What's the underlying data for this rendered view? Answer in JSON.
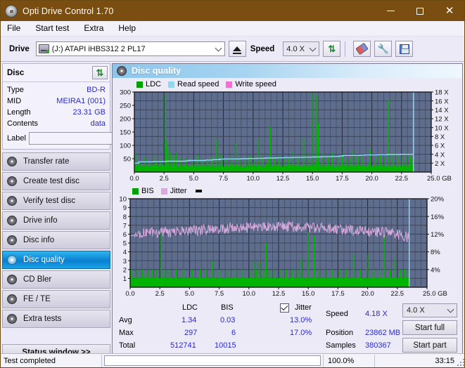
{
  "window": {
    "title": "Opti Drive Control 1.70",
    "icon": "disc-icon",
    "minimize": "–",
    "maximize": "▢",
    "close": "✕"
  },
  "menu": {
    "items": [
      "File",
      "Start test",
      "Extra",
      "Help"
    ]
  },
  "toolbar": {
    "drive_label": "Drive",
    "drive_value": "(J:)  ATAPI iHBS312  2 PL17",
    "eject_title": "Eject",
    "speed_label": "Speed",
    "speed_value": "4.0 X",
    "refresh_title": "Refresh",
    "erase_title": "Erase",
    "tools_title": "Tools",
    "save_title": "Save"
  },
  "disc": {
    "group_title": "Disc",
    "refresh_title": "Refresh disc info",
    "rows": [
      {
        "key": "Type",
        "value": "BD-R"
      },
      {
        "key": "MID",
        "value": "MEIRA1 (001)"
      },
      {
        "key": "Length",
        "value": "23.31 GB"
      },
      {
        "key": "Contents",
        "value": "data"
      }
    ],
    "label_key": "Label",
    "label_value": "",
    "label_placeholder": ""
  },
  "nav": {
    "items": [
      {
        "label": "Transfer rate",
        "active": false
      },
      {
        "label": "Create test disc",
        "active": false
      },
      {
        "label": "Verify test disc",
        "active": false
      },
      {
        "label": "Drive info",
        "active": false
      },
      {
        "label": "Disc info",
        "active": false
      },
      {
        "label": "Disc quality",
        "active": true
      },
      {
        "label": "CD Bler",
        "active": false
      },
      {
        "label": "FE / TE",
        "active": false
      },
      {
        "label": "Extra tests",
        "active": false
      }
    ],
    "status_window": "Status window >>"
  },
  "panel": {
    "title": "Disc quality"
  },
  "colors": {
    "ldc": "#00b400",
    "bis": "#00b400",
    "read_speed": "#8fd8f2",
    "write_speed": "#ff6ad5",
    "jitter": "#d9a8dd",
    "plot_bg": "#5e6d8e",
    "grid": "#3a4358",
    "accent_blue": "#2a2ad0",
    "title_bar": "#7a4d11"
  },
  "stats": {
    "col_headers": [
      "LDC",
      "BIS"
    ],
    "row_labels": [
      "Avg",
      "Max",
      "Total"
    ],
    "ldc": {
      "avg": "1.34",
      "max": "297",
      "total": "512741"
    },
    "bis": {
      "avg": "0.03",
      "max": "6",
      "total": "10015"
    },
    "jitter_label": "Jitter",
    "jitter_checked": true,
    "jitter_avg": "13.0%",
    "jitter_max": "17.0%",
    "speed_label": "Speed",
    "speed_value": "4.18 X",
    "position_label": "Position",
    "position_value": "23862 MB",
    "samples_label": "Samples",
    "samples_value": "380367",
    "speed_select": "4.0 X",
    "start_full": "Start full",
    "start_part": "Start part"
  },
  "statusbar": {
    "message": "Test completed",
    "progress_percent": "100.0%",
    "progress_value": 100,
    "elapsed": "33:15"
  },
  "chart_data": [
    {
      "type": "line",
      "name": "ldc-chart",
      "title": "",
      "legend": [
        {
          "label": "LDC",
          "color": "#00b400"
        },
        {
          "label": "Read speed",
          "color": "#8fd8f2"
        },
        {
          "label": "Write speed",
          "color": "#ff6ad5"
        }
      ],
      "legend_position": "top-left",
      "xlabel": "GB",
      "ylabel": "LDC",
      "xlim": [
        0,
        25
      ],
      "ylim": [
        0,
        300
      ],
      "y2lim": [
        0,
        18
      ],
      "y2label": "X",
      "xticks": [
        0.0,
        2.5,
        5.0,
        7.5,
        10.0,
        12.5,
        15.0,
        17.5,
        20.0,
        22.5,
        25.0
      ],
      "xtick_labels": [
        "0.0",
        "2.5",
        "5.0",
        "7.5",
        "10.0",
        "12.5",
        "15.0",
        "17.5",
        "20.0",
        "22.5",
        "25.0 GB"
      ],
      "yticks": [
        0,
        50,
        100,
        150,
        200,
        250,
        300
      ],
      "ytick_labels": [
        "",
        "50",
        "100",
        "150",
        "200",
        "250",
        "300"
      ],
      "y2ticks": [
        2,
        4,
        6,
        8,
        10,
        12,
        14,
        16,
        18
      ],
      "y2tick_labels": [
        "2 X",
        "4 X",
        "6 X",
        "8 X",
        "10 X",
        "12 X",
        "14 X",
        "16 X",
        "18 X"
      ],
      "grid": true,
      "data_end_x": 23.5,
      "series": [
        {
          "name": "LDC",
          "color": "#00b400",
          "style": "spikes",
          "baseline": 18,
          "noise_amp": 14,
          "spikes": [
            [
              0.05,
              68
            ],
            [
              0.45,
              42
            ],
            [
              0.9,
              55
            ],
            [
              1.35,
              38
            ],
            [
              1.8,
              62
            ],
            [
              2.2,
              48
            ],
            [
              2.62,
              292
            ],
            [
              2.72,
              118
            ],
            [
              2.85,
              96
            ],
            [
              3.05,
              74
            ],
            [
              3.3,
              60
            ],
            [
              3.55,
              70
            ],
            [
              3.9,
              52
            ],
            [
              4.4,
              58
            ],
            [
              4.9,
              46
            ],
            [
              5.3,
              64
            ],
            [
              5.7,
              50
            ],
            [
              6.1,
              44
            ],
            [
              6.5,
              58
            ],
            [
              6.95,
              122
            ],
            [
              7.3,
              66
            ],
            [
              7.7,
              52
            ],
            [
              8.1,
              60
            ],
            [
              8.55,
              108
            ],
            [
              8.9,
              58
            ],
            [
              9.3,
              50
            ],
            [
              9.7,
              64
            ],
            [
              10.1,
              56
            ],
            [
              10.45,
              126
            ],
            [
              10.8,
              60
            ],
            [
              11.2,
              52
            ],
            [
              11.45,
              170
            ],
            [
              11.8,
              58
            ],
            [
              12.2,
              64
            ],
            [
              12.6,
              50
            ],
            [
              13.0,
              56
            ],
            [
              13.4,
              76
            ],
            [
              13.8,
              62
            ],
            [
              14.25,
              128
            ],
            [
              14.6,
              66
            ],
            [
              14.98,
              297
            ],
            [
              15.35,
              290
            ],
            [
              15.5,
              184
            ],
            [
              15.9,
              70
            ],
            [
              16.3,
              60
            ],
            [
              16.7,
              74
            ],
            [
              17.1,
              58
            ],
            [
              17.5,
              66
            ],
            [
              17.9,
              52
            ],
            [
              18.4,
              80
            ],
            [
              18.8,
              64
            ],
            [
              19.2,
              58
            ],
            [
              19.85,
              86
            ],
            [
              20.3,
              56
            ],
            [
              20.7,
              62
            ],
            [
              21.1,
              58
            ],
            [
              21.45,
              272
            ],
            [
              21.8,
              70
            ],
            [
              22.2,
              66
            ],
            [
              22.55,
              58
            ],
            [
              22.9,
              74
            ],
            [
              23.2,
              60
            ],
            [
              23.4,
              52
            ]
          ]
        },
        {
          "name": "Read speed",
          "color": "#8fd8f2",
          "style": "step-line",
          "axis": "y2",
          "points": [
            [
              0.0,
              2.0
            ],
            [
              0.3,
              2.0
            ],
            [
              0.35,
              2.3
            ],
            [
              1.5,
              2.3
            ],
            [
              1.6,
              2.35
            ],
            [
              2.6,
              2.4
            ],
            [
              2.7,
              2.45
            ],
            [
              4.3,
              2.5
            ],
            [
              4.5,
              2.6
            ],
            [
              6.0,
              2.7
            ],
            [
              6.6,
              2.8
            ],
            [
              7.2,
              2.9
            ],
            [
              7.6,
              2.95
            ],
            [
              9.0,
              3.0
            ],
            [
              9.6,
              3.05
            ],
            [
              10.3,
              3.1
            ],
            [
              11.0,
              3.15
            ],
            [
              12.0,
              3.2
            ],
            [
              12.6,
              3.25
            ],
            [
              13.4,
              3.3
            ],
            [
              14.2,
              3.35
            ],
            [
              15.0,
              3.4
            ],
            [
              15.8,
              3.45
            ],
            [
              16.6,
              3.5
            ],
            [
              17.3,
              3.6
            ],
            [
              17.6,
              3.75
            ],
            [
              19.0,
              3.8
            ],
            [
              19.4,
              3.85
            ],
            [
              20.5,
              3.9
            ],
            [
              21.3,
              3.95
            ],
            [
              22.4,
              4.0
            ],
            [
              23.4,
              4.0
            ],
            [
              23.5,
              18.0
            ]
          ]
        }
      ]
    },
    {
      "type": "line",
      "name": "bis-jitter-chart",
      "title": "",
      "legend": [
        {
          "label": "BIS",
          "color": "#00b400"
        },
        {
          "label": "Jitter",
          "color": "#d9a8dd"
        }
      ],
      "legend_position": "top-left",
      "xlabel": "GB",
      "ylabel": "BIS",
      "xlim": [
        0,
        25
      ],
      "ylim": [
        0,
        10
      ],
      "y2lim": [
        0,
        20
      ],
      "y2label": "%",
      "xticks": [
        0.0,
        2.5,
        5.0,
        7.5,
        10.0,
        12.5,
        15.0,
        17.5,
        20.0,
        22.5,
        25.0
      ],
      "xtick_labels": [
        "0.0",
        "2.5",
        "5.0",
        "7.5",
        "10.0",
        "12.5",
        "15.0",
        "17.5",
        "20.0",
        "22.5",
        "25.0 GB"
      ],
      "yticks": [
        1,
        2,
        3,
        4,
        5,
        6,
        7,
        8,
        9,
        10
      ],
      "ytick_labels": [
        "1",
        "2",
        "3",
        "4",
        "5",
        "6",
        "7",
        "8",
        "9",
        "10"
      ],
      "y2ticks": [
        4,
        8,
        12,
        16,
        20
      ],
      "y2tick_labels": [
        "4%",
        "8%",
        "12%",
        "16%",
        "20%"
      ],
      "grid": true,
      "data_end_x": 23.5,
      "series": [
        {
          "name": "BIS",
          "color": "#00b400",
          "style": "spikes",
          "baseline": 1,
          "noise_amp": 0.08,
          "spikes": [
            [
              0.08,
              2
            ],
            [
              0.6,
              2
            ],
            [
              1.05,
              2
            ],
            [
              1.3,
              1.5
            ],
            [
              1.55,
              2
            ],
            [
              1.9,
              2
            ],
            [
              2.25,
              2
            ],
            [
              2.62,
              6
            ],
            [
              2.95,
              2
            ],
            [
              3.25,
              2
            ],
            [
              3.9,
              2
            ],
            [
              4.5,
              2
            ],
            [
              5.2,
              2
            ],
            [
              5.9,
              2
            ],
            [
              6.4,
              2
            ],
            [
              6.95,
              3
            ],
            [
              7.5,
              2
            ],
            [
              8.2,
              2
            ],
            [
              8.9,
              2
            ],
            [
              9.5,
              2
            ],
            [
              10.1,
              2
            ],
            [
              10.45,
              3
            ],
            [
              10.65,
              2
            ],
            [
              10.9,
              3
            ],
            [
              11.2,
              2
            ],
            [
              11.45,
              5
            ],
            [
              11.7,
              2
            ],
            [
              12.1,
              2
            ],
            [
              12.6,
              2
            ],
            [
              13.1,
              2
            ],
            [
              13.6,
              2
            ],
            [
              14.1,
              2
            ],
            [
              14.4,
              3.2
            ],
            [
              14.98,
              6.2
            ],
            [
              15.5,
              5.8
            ],
            [
              15.9,
              2
            ],
            [
              16.4,
              2
            ],
            [
              17.0,
              2
            ],
            [
              17.6,
              2
            ],
            [
              18.2,
              2
            ],
            [
              18.85,
              3.8
            ],
            [
              19.4,
              2
            ],
            [
              19.95,
              3.7
            ],
            [
              20.5,
              2
            ],
            [
              21.0,
              2
            ],
            [
              21.45,
              6.1
            ],
            [
              21.9,
              2
            ],
            [
              22.3,
              3.2
            ],
            [
              22.7,
              2
            ],
            [
              23.1,
              2
            ],
            [
              23.35,
              2
            ]
          ]
        },
        {
          "name": "Jitter",
          "color": "#d9a8dd",
          "style": "noisy-line",
          "axis": "y2",
          "trend": [
            [
              0.0,
              11.6
            ],
            [
              0.5,
              11.9
            ],
            [
              1.0,
              12.2
            ],
            [
              2.0,
              12.4
            ],
            [
              3.0,
              12.5
            ],
            [
              4.0,
              12.6
            ],
            [
              5.0,
              12.7
            ],
            [
              6.0,
              12.9
            ],
            [
              7.0,
              13.1
            ],
            [
              8.0,
              13.3
            ],
            [
              9.0,
              13.4
            ],
            [
              10.0,
              13.5
            ],
            [
              11.0,
              13.6
            ],
            [
              12.0,
              13.6
            ],
            [
              13.0,
              13.7
            ],
            [
              14.0,
              13.6
            ],
            [
              15.0,
              13.5
            ],
            [
              16.0,
              13.4
            ],
            [
              17.0,
              13.3
            ],
            [
              18.0,
              13.0
            ],
            [
              19.0,
              12.7
            ],
            [
              20.0,
              12.5
            ],
            [
              21.0,
              12.4
            ],
            [
              22.0,
              12.3
            ],
            [
              23.0,
              11.6
            ],
            [
              23.4,
              11.2
            ]
          ],
          "noise_amp": 1.2
        }
      ]
    }
  ]
}
